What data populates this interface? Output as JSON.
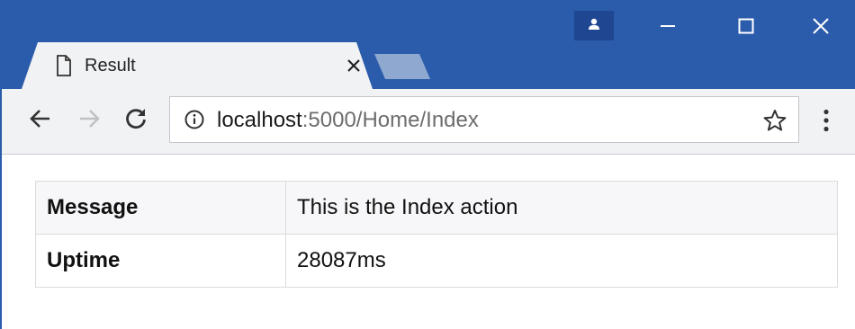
{
  "tab": {
    "title": "Result"
  },
  "address_bar": {
    "host": "localhost",
    "path": ":5000/Home/Index"
  },
  "icons": {
    "profile": "person-icon",
    "minimize": "minimize-icon",
    "maximize": "maximize-icon",
    "close": "close-icon",
    "page": "document-icon",
    "back": "back-arrow-icon",
    "forward": "forward-arrow-icon",
    "reload": "reload-icon",
    "info": "info-icon",
    "bookmark": "star-icon",
    "menu": "kebab-menu-icon"
  },
  "colors": {
    "titlebar": "#2b5cab",
    "toolbar": "#f1f2f4",
    "table_border": "#dcdcdc"
  },
  "table": {
    "rows": [
      {
        "key": "Message",
        "value": "This is the Index action"
      },
      {
        "key": "Uptime",
        "value": "28087ms"
      }
    ]
  }
}
